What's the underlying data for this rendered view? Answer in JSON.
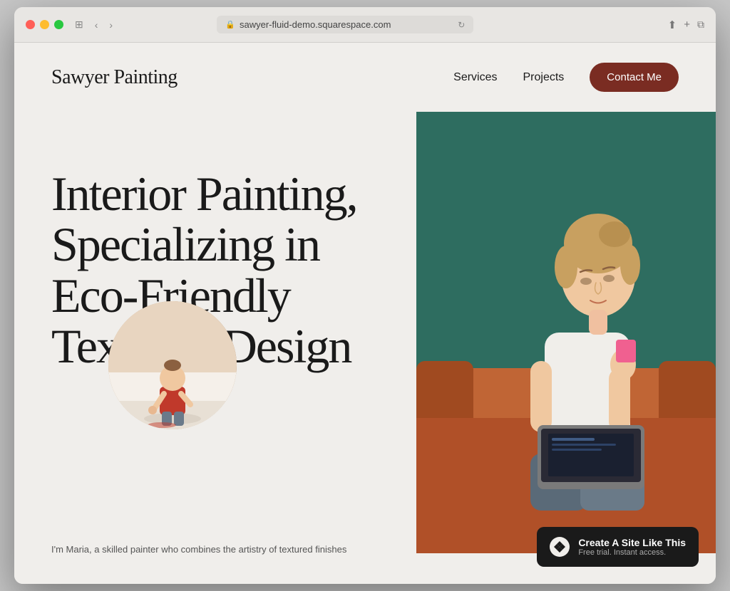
{
  "browser": {
    "url": "sawyer-fluid-demo.squarespace.com",
    "refresh_label": "↻"
  },
  "nav": {
    "logo": "Sawyer Painting",
    "links": [
      {
        "label": "Services",
        "href": "#services"
      },
      {
        "label": "Projects",
        "href": "#projects"
      }
    ],
    "cta": "Contact Me"
  },
  "hero": {
    "heading": "Interior Painting, Specializing in Eco-Friendly Textured Design",
    "caption": "I'm Maria, a skilled painter who combines the artistry of textured finishes"
  },
  "badge": {
    "main_text": "Create A Site Like This",
    "sub_text": "Free trial. Instant access."
  },
  "colors": {
    "background": "#f0eeeb",
    "cta_bg": "#7a2c22",
    "text_dark": "#1a1a1a",
    "badge_bg": "#1a1a1a"
  }
}
